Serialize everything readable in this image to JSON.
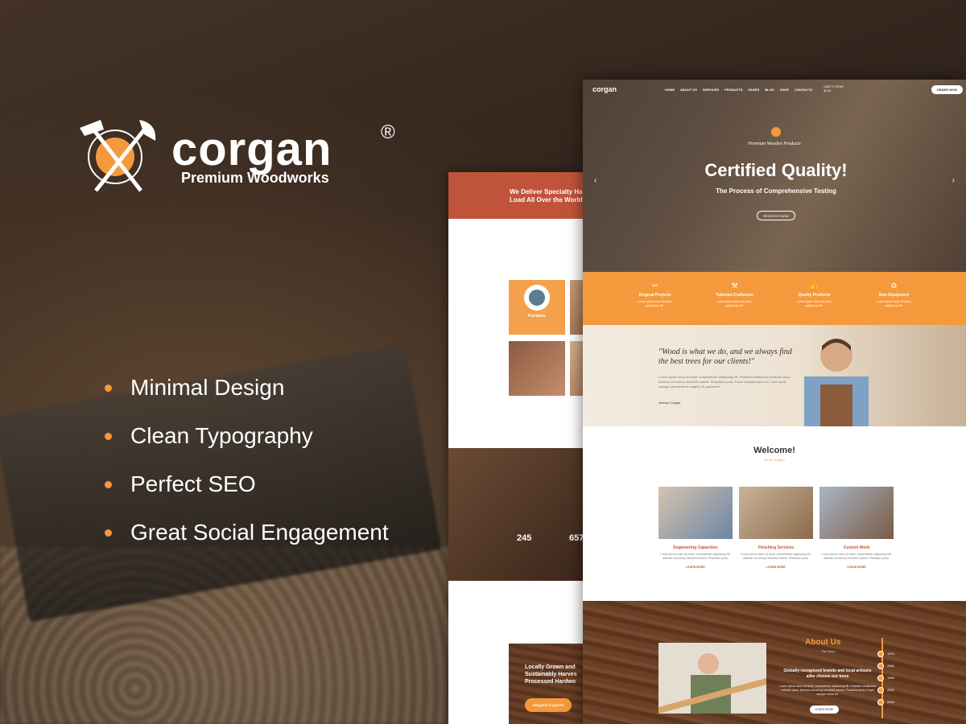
{
  "brand": {
    "name": "corgan",
    "reg": "®",
    "tagline": "Premium Woodworks",
    "accent": "#f59a3c",
    "accent_dark": "#c0543a"
  },
  "features": [
    "Minimal Design",
    "Clean Typography",
    "Perfect SEO",
    "Great Social Engagement"
  ],
  "back_preview": {
    "banner": "We Deliver Specialty Ha\nLoad All Over the World",
    "tile_label": "Furniture",
    "stats": [
      {
        "value": "245"
      },
      {
        "value": "657"
      }
    ],
    "wood_text": "Locally Grown and\nSustainably Harves\nProcessed Hardwo",
    "quote_button": "REQUEST A QUOTE"
  },
  "front_preview": {
    "nav": {
      "brand": "corgan",
      "menu": [
        "HOME",
        "ABOUT US",
        "SERVICES",
        "PRODUCTS",
        "PAGES",
        "BLOG",
        "SHOP",
        "CONTACTS"
      ],
      "cart": "CART: 0 ITEMS\n$0.00",
      "order": "ORDER NOW"
    },
    "hero": {
      "pre": "Premium Wooden Products",
      "title": "Certified Quality!",
      "subtitle": "The Process of Comprehensive Testing",
      "button": "REGISTER NOW"
    },
    "features": [
      {
        "icon": "saw-icon",
        "title": "Original Projects",
        "desc": "Lorem ipsum dolor sit amet,\nadipiscing elit."
      },
      {
        "icon": "hammer-icon",
        "title": "Talented Craftsmen",
        "desc": "Lorem ipsum dolor sit amet,\nadipiscing elit."
      },
      {
        "icon": "thumbs-up-icon",
        "title": "Quality Products",
        "desc": "Lorem ipsum dolor sit amet,\nadipiscing elit."
      },
      {
        "icon": "plane-tool-icon",
        "title": "New Equipment",
        "desc": "Lorem ipsum dolor sit amet,\nadipiscing elit."
      }
    ],
    "quote": {
      "text": "\"Wood is what we do, and we always find the best trees for our clients!\"",
      "body": "Lorem ipsum dolor sit amet, consectetuer adipiscing elit. Praesent vestibulum molestie lacus. Aenean nonummy hendrerit mauris. Phasellus porta. Fusce suscipit varius mi. Cum sociis natoque penatibus et magnis dis parturient.",
      "author": "Jeremy Corgan"
    },
    "welcome": {
      "title": "Welcome!",
      "subtitle": "To the Corgan"
    },
    "services": [
      {
        "title": "Engineering Capacities",
        "desc": "Lorem ipsum dolor sit amet, consectetuer adipiscing elit. Aenean nonummy hendrerit mauris. Phasellus porta.",
        "link": "LEARN MORE"
      },
      {
        "title": "Finishing Services",
        "desc": "Lorem ipsum dolor sit amet, consectetuer adipiscing elit. Aenean nonummy hendrerit mauris. Phasellus porta.",
        "link": "LEARN MORE"
      },
      {
        "title": "Custom Work",
        "desc": "Lorem ipsum dolor sit amet, consectetuer adipiscing elit. Aenean nonummy hendrerit mauris. Phasellus porta.",
        "link": "LEARN MORE"
      }
    ],
    "about": {
      "title": "About Us",
      "subtitle": "The Story",
      "heading": "Globally recognized brands and local artisans alike choose our trees",
      "desc": "Lorem ipsum dolor sit amet, consectetuer adipiscing elit. Praesent vestibulum molestie lacus. Aenean nonummy hendrerit mauris. Phasellus porta. Fusce suscipit varius mi.",
      "button": "LEARN MORE",
      "timeline": [
        "1974",
        "1981",
        "1993",
        "2002",
        "2016"
      ]
    }
  }
}
